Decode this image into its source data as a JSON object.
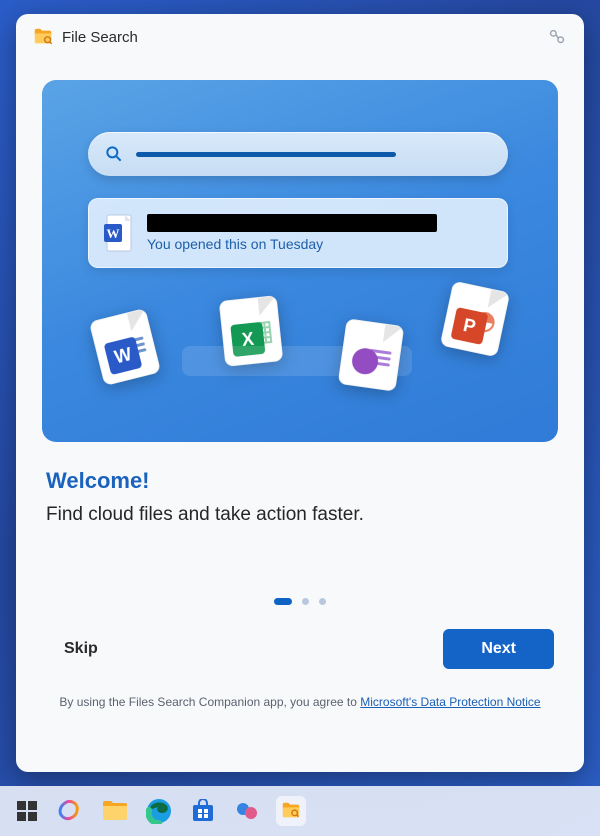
{
  "header": {
    "title": "File Search"
  },
  "hero": {
    "card_subtitle": "You opened this on Tuesday"
  },
  "content": {
    "welcome": "Welcome!",
    "subtitle": "Find cloud files and take action faster."
  },
  "pager": {
    "current": 1,
    "total": 3
  },
  "buttons": {
    "skip": "Skip",
    "next": "Next"
  },
  "footer": {
    "prefix": "By using the Files Search Companion app, you agree to ",
    "link_text": "Microsoft's Data Protection Notice"
  },
  "colors": {
    "word": "#2a5ac8",
    "excel": "#149954",
    "onenote": "#8434b9",
    "powerpoint": "#d64729",
    "primary": "#1464c8"
  }
}
